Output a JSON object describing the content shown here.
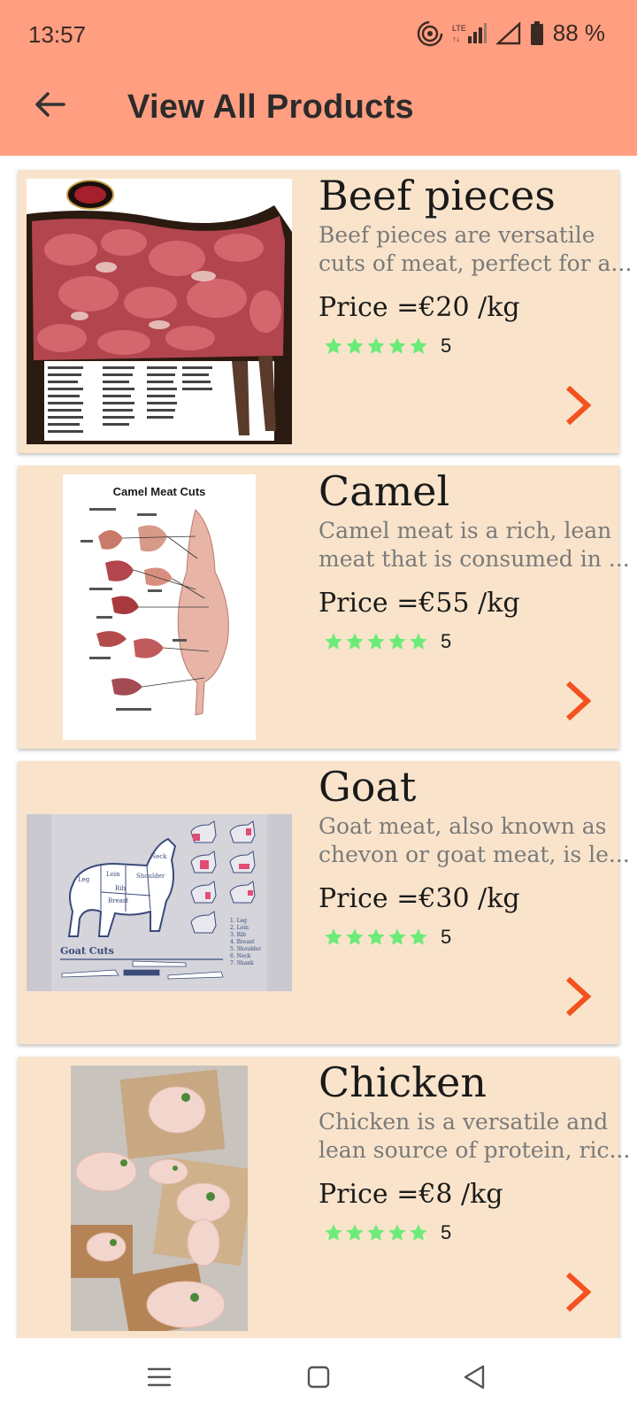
{
  "status": {
    "time": "13:57",
    "battery": "88 %",
    "icons": [
      "hotspot-icon",
      "lte-signal-icon",
      "signal-icon",
      "battery-icon"
    ]
  },
  "appbar": {
    "title": "View All Products",
    "back_icon": "arrow-left-icon"
  },
  "colors": {
    "topbar": "#FF9E80",
    "card": "#F9E4CB",
    "star": "#6DEB79",
    "chevron": "#F4511E"
  },
  "products": [
    {
      "name": "Beef pieces",
      "description": "Beef pieces are versatile cuts of meat, perfect for a...",
      "price": "Price =€20 /kg",
      "rating": "5",
      "rating_stars": 5,
      "image": "beef-cuts-chart-image"
    },
    {
      "name": "Camel",
      "description": "Camel meat is a rich, lean meat that is consumed in ...",
      "price": "Price =€55 /kg",
      "rating": "5",
      "rating_stars": 5,
      "image_title": "Camel Meat Cuts",
      "image": "camel-cuts-chart-image"
    },
    {
      "name": "Goat",
      "description": "Goat meat, also known as chevon or goat meat, is le...",
      "price": "Price =€30 /kg",
      "rating": "5",
      "rating_stars": 5,
      "image_title": "Goat Cuts",
      "image": "goat-cuts-chart-image"
    },
    {
      "name": "Chicken",
      "description": "Chicken is a versatile and lean source of protein, ric...",
      "price": "Price =€8 /kg",
      "rating": "5",
      "rating_stars": 5,
      "image": "raw-chicken-photo"
    }
  ],
  "navbar": {
    "icons": [
      "menu-icon",
      "home-square-icon",
      "back-triangle-icon"
    ]
  }
}
